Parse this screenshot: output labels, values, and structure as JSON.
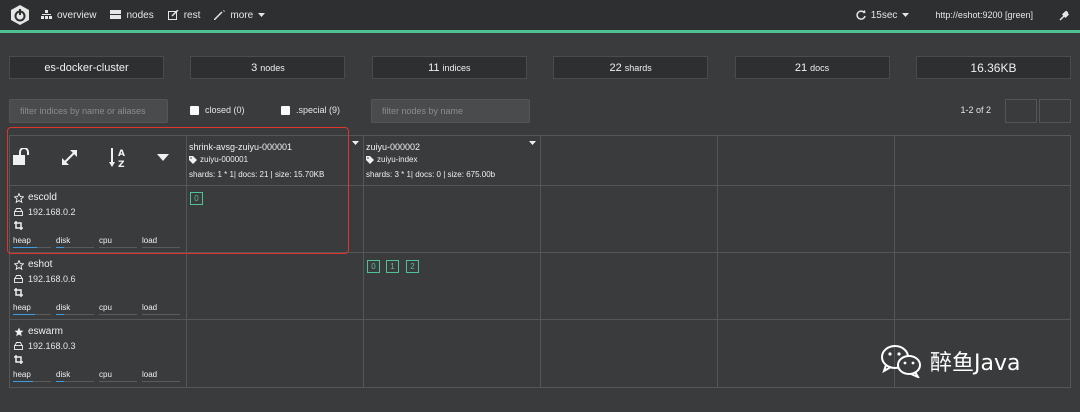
{
  "topnav": {
    "overview": "overview",
    "nodes": "nodes",
    "rest": "rest",
    "more": "more",
    "refresh": "15sec",
    "host": "http://eshot:9200 [green]"
  },
  "stats": {
    "cluster_name": "es-docker-cluster",
    "nodes_count": "3",
    "nodes_label": "nodes",
    "indices_count": "11",
    "indices_label": "indices",
    "shards_count": "22",
    "shards_label": "shards",
    "docs_count": "21",
    "docs_label": "docs",
    "size": "16.36KB"
  },
  "filters": {
    "indices_placeholder": "filter indices by name or aliases",
    "closed_label": "closed (0)",
    "special_label": ".special (9)",
    "nodes_placeholder": "filter nodes by name",
    "pagination": "1-2 of 2"
  },
  "indices": [
    {
      "name": "shrink-avsg-zuiyu-000001",
      "alias": "zuiyu-000001",
      "stats": "shards: 1 * 1| docs: 21 | size: 15.70KB"
    },
    {
      "name": "zuiyu-000002",
      "alias": "zuiyu-index",
      "stats": "shards: 3 * 1| docs: 0 | size: 675.00b"
    }
  ],
  "nodes": [
    {
      "name": "escold",
      "ip": "192.168.0.2",
      "master": false
    },
    {
      "name": "eshot",
      "ip": "192.168.0.6",
      "master": false
    },
    {
      "name": "eswarm",
      "ip": "192.168.0.3",
      "master": true
    }
  ],
  "metric_labels": {
    "heap": "heap",
    "disk": "disk",
    "cpu": "cpu",
    "load": "load"
  },
  "shards": {
    "escold_idx1": [
      "0"
    ],
    "eshot_idx2": [
      "0",
      "1",
      "2"
    ]
  },
  "watermark": "醉鱼Java",
  "colors": {
    "accent": "#4fc293",
    "highlight": "#e0352b",
    "metric": "#3f9be0"
  }
}
